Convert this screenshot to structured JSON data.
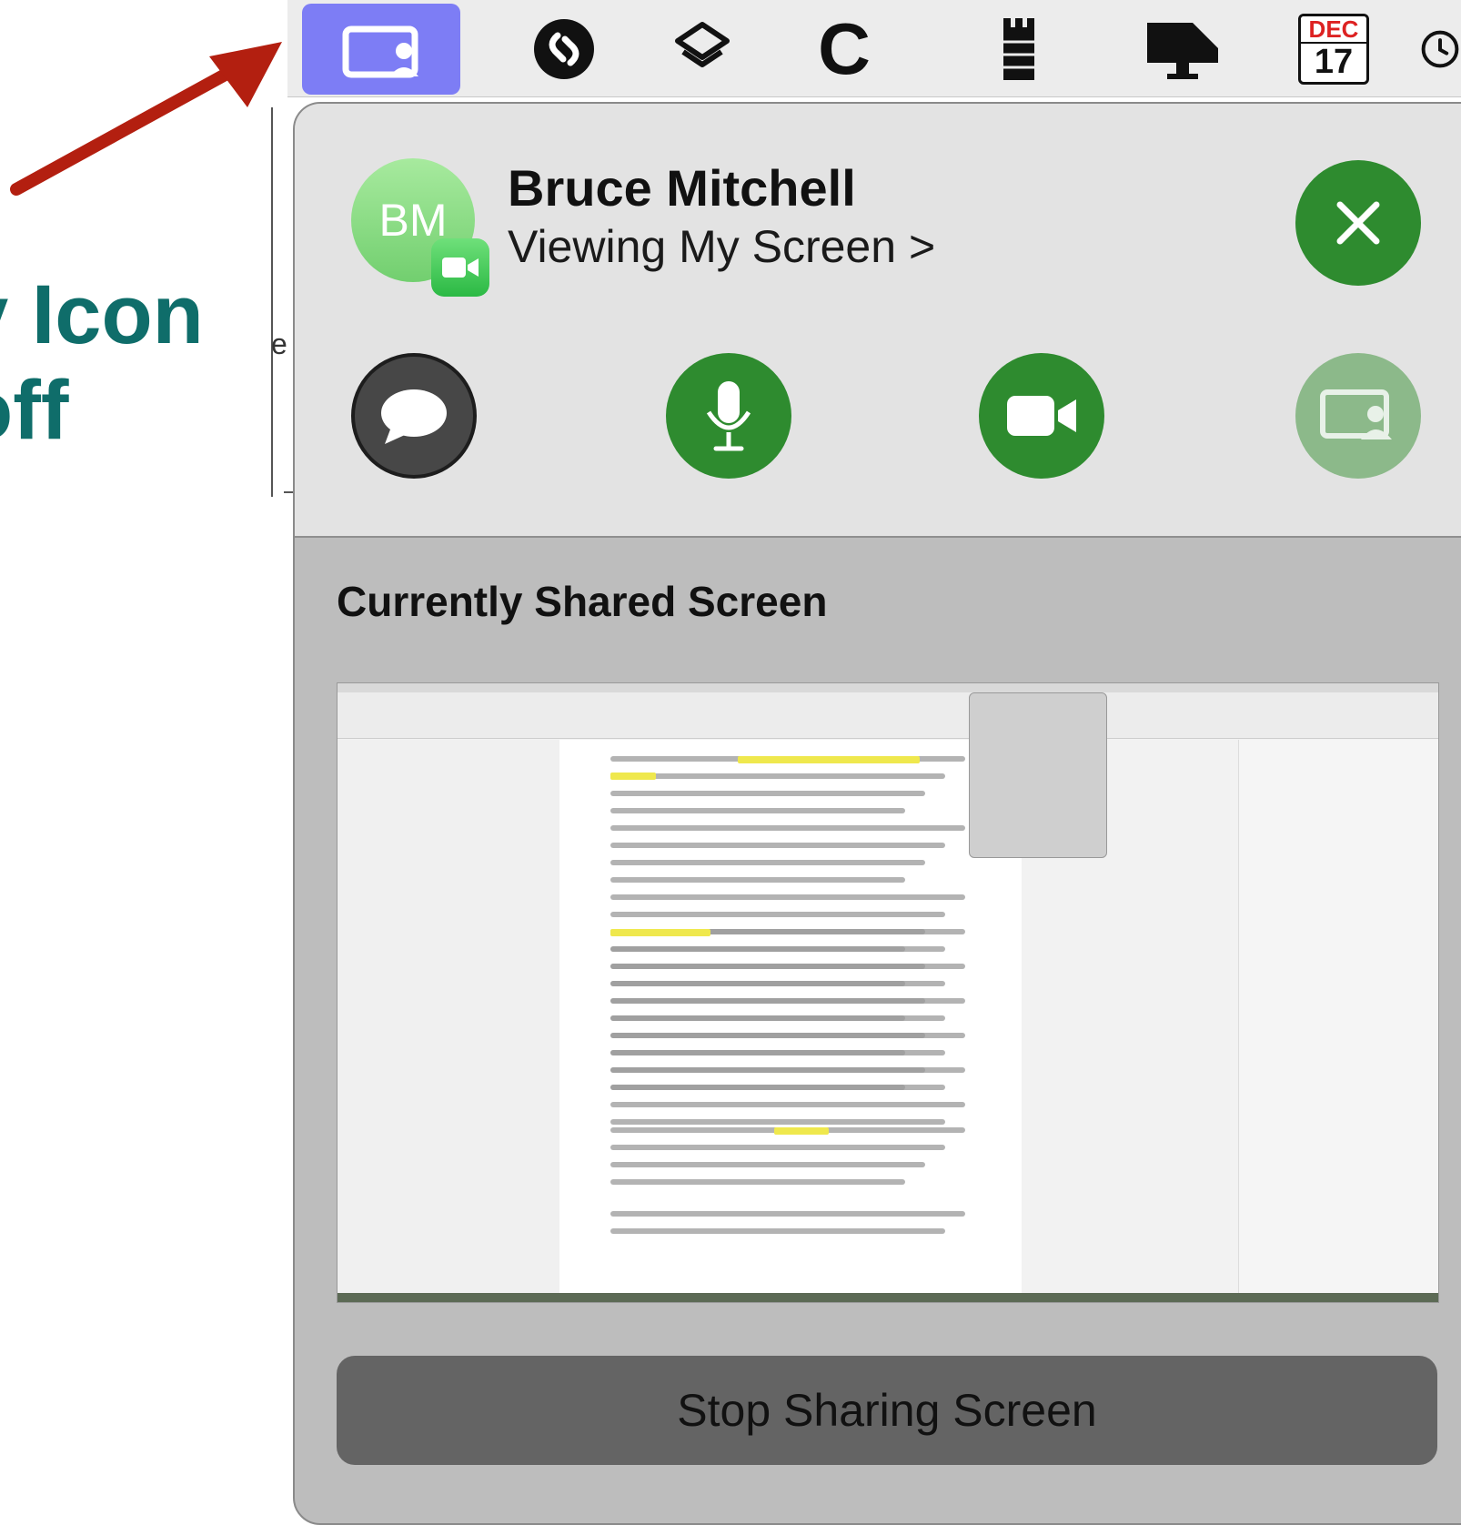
{
  "menubar": {
    "items": [
      {
        "icon": "screen-share-icon",
        "active": true
      },
      {
        "icon": "shazam-icon"
      },
      {
        "icon": "shortcuts-icon"
      },
      {
        "icon": "c-app-icon",
        "glyph": "C"
      },
      {
        "icon": "tower-icon"
      },
      {
        "icon": "display-icon"
      },
      {
        "icon": "calendar-icon",
        "month": "DEC",
        "day": "17"
      },
      {
        "icon": "clock-icon"
      }
    ]
  },
  "annotation": {
    "line1": "v Icon",
    "line2": "off",
    "arrow_color": "#b31f10",
    "text_color": "#0f6d6a"
  },
  "panel": {
    "avatar_initials": "BM",
    "person_name": "Bruce Mitchell",
    "status": "Viewing My Screen >",
    "controls": [
      {
        "name": "messages",
        "icon": "message-bubble-icon"
      },
      {
        "name": "microphone",
        "icon": "microphone-icon"
      },
      {
        "name": "camera",
        "icon": "video-camera-icon"
      },
      {
        "name": "screen-share",
        "icon": "screen-share-icon"
      }
    ],
    "section_title": "Currently Shared Screen",
    "stop_label": "Stop Sharing Screen",
    "colors": {
      "green": "#2e8b2f",
      "light_green": "#8cb98a",
      "active_menu": "#7d7df5"
    }
  }
}
